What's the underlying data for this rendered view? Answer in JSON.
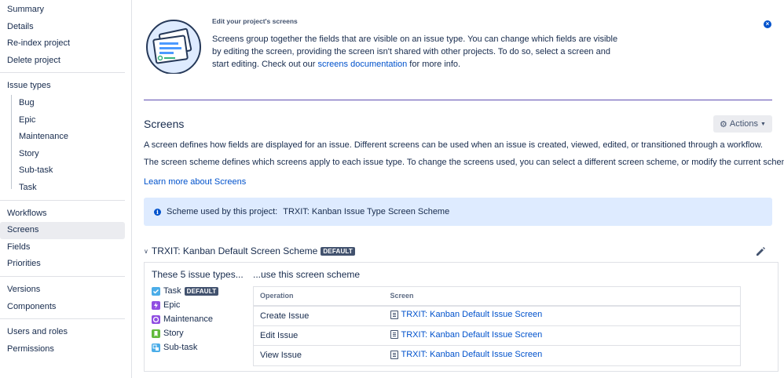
{
  "sidebar": {
    "group1": [
      "Summary",
      "Details",
      "Re-index project",
      "Delete project"
    ],
    "issue_types_label": "Issue types",
    "issue_types": [
      "Bug",
      "Epic",
      "Maintenance",
      "Story",
      "Sub-task",
      "Task"
    ],
    "group3": [
      "Workflows",
      "Screens",
      "Fields",
      "Priorities"
    ],
    "group4": [
      "Versions",
      "Components"
    ],
    "group5": [
      "Users and roles",
      "Permissions"
    ]
  },
  "flag": {
    "title": "Edit your project's screens",
    "body_1": "Screens group together the fields that are visible on an issue type. You can change which fields are visible by editing the screen, providing the screen isn't shared with other projects. To do so, select a screen and start editing. Check out our ",
    "link": "screens documentation",
    "body_2": " for more info."
  },
  "screens": {
    "title": "Screens",
    "actions_label": "Actions",
    "p1": "A screen defines how fields are displayed for an issue. Different screens can be used when an issue is created, viewed, edited, or transitioned through a workflow.",
    "p2": "The screen scheme defines which screens apply to each issue type. To change the screens used, you can select a different screen scheme, or modify the current scheme.",
    "learn_more": "Learn more about Screens",
    "info_label": "Scheme used by this project:",
    "info_value": "TRXIT: Kanban Issue Type Screen Scheme"
  },
  "scheme": {
    "name": "TRXIT: Kanban Default Screen Scheme",
    "default_badge": "DEFAULT",
    "left_title": "These 5 issue types...",
    "right_title": "...use this screen scheme",
    "issue_types": [
      {
        "name": "Task",
        "default": "DEFAULT",
        "color": "#4bade8",
        "icon": "checkbox-icon"
      },
      {
        "name": "Epic",
        "default": "",
        "color": "#904ee2",
        "icon": "bolt-icon"
      },
      {
        "name": "Maintenance",
        "default": "",
        "color": "#904ee2",
        "icon": "circle-icon"
      },
      {
        "name": "Story",
        "default": "",
        "color": "#63ba3c",
        "icon": "bookmark-icon"
      },
      {
        "name": "Sub-task",
        "default": "",
        "color": "#4bade8",
        "icon": "subtask-icon"
      }
    ],
    "table": {
      "headers": [
        "Operation",
        "Screen"
      ],
      "rows": [
        {
          "operation": "Create Issue",
          "screen": "TRXIT: Kanban Default Issue Screen"
        },
        {
          "operation": "Edit Issue",
          "screen": "TRXIT: Kanban Default Issue Screen"
        },
        {
          "operation": "View Issue",
          "screen": "TRXIT: Kanban Default Issue Screen"
        }
      ]
    }
  }
}
